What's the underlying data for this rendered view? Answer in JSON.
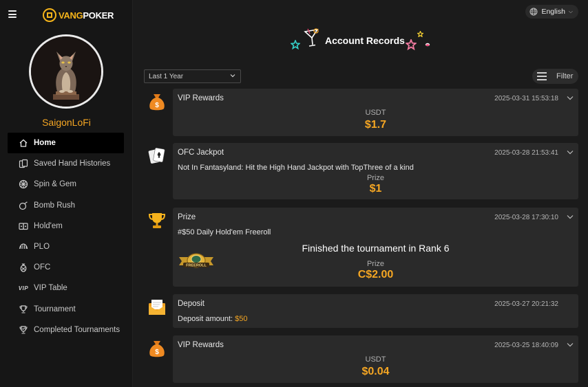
{
  "app": {
    "logo_prefix": "VANG",
    "logo_suffix": "POKER"
  },
  "user": {
    "name": "SaigonLoFi"
  },
  "nav": [
    {
      "label": "Home",
      "icon": "home-icon",
      "active": true
    },
    {
      "label": "Saved Hand Histories",
      "icon": "cards-icon"
    },
    {
      "label": "Spin & Gem",
      "icon": "wheel-icon"
    },
    {
      "label": "Bomb Rush",
      "icon": "bomb-icon"
    },
    {
      "label": "Hold'em",
      "icon": "holdem-icon"
    },
    {
      "label": "PLO",
      "icon": "plo-icon"
    },
    {
      "label": "OFC",
      "icon": "pineapple-icon"
    },
    {
      "label": "VIP Table",
      "icon": "vip-icon",
      "icon_text": "VIP"
    },
    {
      "label": "Tournament",
      "icon": "trophy-icon"
    },
    {
      "label": "Completed Tournaments",
      "icon": "trophy-check-icon"
    }
  ],
  "header": {
    "language": "English",
    "title": "Account Records"
  },
  "controls": {
    "period": "Last 1 Year",
    "filter": "Filter"
  },
  "records": [
    {
      "type": "VIP Rewards",
      "time": "2025-03-31 15:53:18",
      "label": "USDT",
      "amount": "$1.7",
      "icon": "money-bag-icon"
    },
    {
      "type": "OFC Jackpot",
      "time": "2025-03-28 21:53:41",
      "description": "Not In Fantasyland: Hit the High Hand Jackpot with TopThree of a kind",
      "label": "Prize",
      "amount": "$1",
      "icon": "playing-cards-icon"
    },
    {
      "type": "Prize",
      "time": "2025-03-28 17:30:10",
      "description": "#$50 Daily Hold'em Freeroll",
      "result": "Finished the tournament in Rank 6",
      "label": "Prize",
      "amount": "C$2.00",
      "icon": "trophy-icon",
      "badge_text": "FREEROLL"
    },
    {
      "type": "Deposit",
      "time": "2025-03-27 20:21:32",
      "description_prefix": "Deposit amount: ",
      "description_amount": "$50",
      "icon": "envelope-icon"
    },
    {
      "type": "VIP Rewards",
      "time": "2025-03-25 18:40:09",
      "label": "USDT",
      "amount": "$0.04",
      "icon": "money-bag-icon"
    }
  ],
  "colors": {
    "accent": "#f5a623",
    "background": "#1b1b1b",
    "card": "#2a2a2a",
    "sidebar": "#161616"
  }
}
